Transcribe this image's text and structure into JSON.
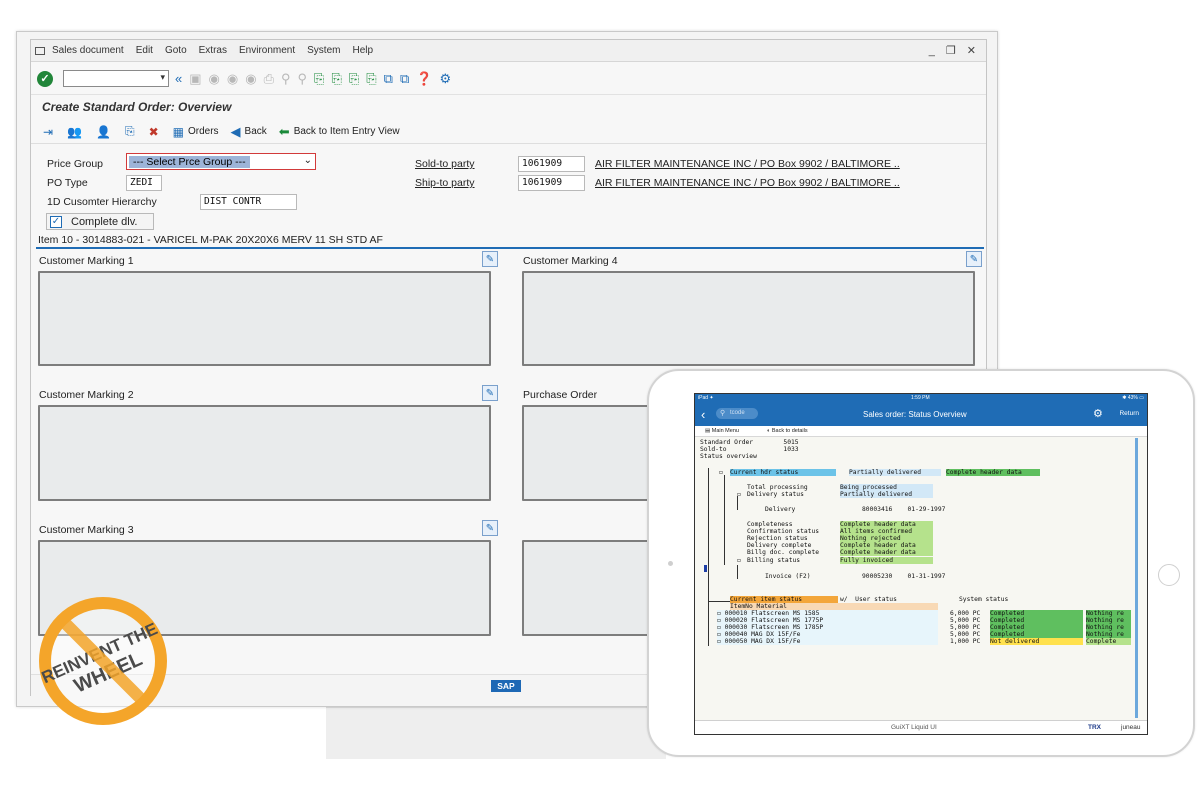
{
  "sap": {
    "menu": [
      "Sales document",
      "Edit",
      "Goto",
      "Extras",
      "Environment",
      "System",
      "Help"
    ],
    "window_controls": "_ ❐ ✕",
    "title": "Create Standard Order: Overview",
    "toolbar2": {
      "orders": "Orders",
      "back": "Back",
      "back_item_entry": "Back to Item Entry View"
    },
    "fields": {
      "price_group_label": "Price Group",
      "price_group_value": "--- Select Prce Group ---",
      "po_type_label": "PO Type",
      "po_type_value": "ZEDI",
      "hierarchy_label": "1D Cusomter Hierarchy",
      "hierarchy_value": "DIST CONTR",
      "complete_dlv_label": "Complete dlv.",
      "sold_to_label": "Sold-to party",
      "sold_to_value": "1061909",
      "sold_to_name": "AIR FILTER MAINTENANCE INC / PO Box 9902 / BALTIMORE ..",
      "ship_to_label": "Ship-to party",
      "ship_to_value": "1061909",
      "ship_to_name": "AIR FILTER MAINTENANCE INC / PO Box 9902 / BALTIMORE .."
    },
    "item_line": "Item 10 - 3014883-021 - VARICEL M-PAK 20X20X6 MERV 11 SH STD AF",
    "panels": {
      "cm1": "Customer Marking 1",
      "cm2": "Customer Marking 2",
      "cm3": "Customer Marking 3",
      "cm4": "Customer Marking 4",
      "po": "Purchase Order"
    },
    "logo": "SAP"
  },
  "badge": {
    "line1": "REINVENT THE",
    "line2": "WHEEL"
  },
  "tablet": {
    "status_left": "iPad ✦",
    "status_time": "1:59 PM",
    "status_right": "✱ 43% ▭",
    "search_placeholder": "tcode",
    "title": "Sales order: Status Overview",
    "return": "Return",
    "main_menu": "Main Menu",
    "back_details": "Back to details",
    "header_lines": [
      "Standard Order        5015",
      "Sold-to               1033",
      "Status overview"
    ],
    "current_hdr_status": "Current hdr status",
    "partially_delivered": "Partially delivered",
    "complete_header_data": "Complete header data",
    "tree_rows": [
      {
        "label": "Total processing",
        "value": "Being processed"
      },
      {
        "label": "Delivery status",
        "value": "Partially delivered"
      },
      {
        "label": "Delivery",
        "value": "80003416    01-29-1997"
      },
      {
        "label": "Completeness",
        "value": "Complete header data"
      },
      {
        "label": "Confirmation status",
        "value": "All items confirmed"
      },
      {
        "label": "Rejection status",
        "value": "Nothing rejected"
      },
      {
        "label": "Delivery complete",
        "value": "Complete header data"
      },
      {
        "label": "Billg doc. complete",
        "value": "Complete header data"
      },
      {
        "label": "Billing status",
        "value": "Fully invoiced"
      },
      {
        "label": "Invoice (F2)",
        "value": "90005230    01-31-1997"
      }
    ],
    "item_header": "Current item status",
    "item_user_status": "w/  User status",
    "item_system_status": "System status",
    "item_cols": "ItemNo Material",
    "items": [
      {
        "item": "000010 Flatscreen MS 1585",
        "qty": "6,000 PC",
        "status": "Completed",
        "sys": "Nothing re"
      },
      {
        "item": "000020 Flatscreen MS 1775P",
        "qty": "5,000 PC",
        "status": "Completed",
        "sys": "Nothing re"
      },
      {
        "item": "000030 Flatscreen MS 1785P",
        "qty": "5,000 PC",
        "status": "Completed",
        "sys": "Nothing re"
      },
      {
        "item": "000040 MAG DX 15F/Fe",
        "qty": "5,000 PC",
        "status": "Completed",
        "sys": "Nothing re"
      },
      {
        "item": "000050 MAG DX 15F/Fe",
        "qty": "1,000 PC",
        "status": "Not delivered",
        "sys": "Complete"
      }
    ],
    "footer_center": "GuiXT Liquid UI",
    "footer_trx": "TRX",
    "footer_right": "juneau"
  }
}
